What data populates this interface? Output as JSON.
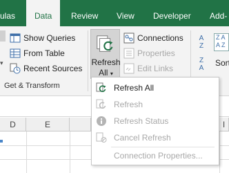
{
  "tabs": [
    "ulas",
    "Data",
    "Review",
    "View",
    "Developer",
    "Add-"
  ],
  "ribbon": {
    "queries": {
      "show_queries": "Show Queries",
      "from_table": "From Table",
      "recent_sources": "Recent Sources"
    },
    "group_get_transform": "Get & Transform",
    "refresh_all_line1": "Refresh",
    "refresh_all_line2": "All",
    "connections": {
      "connections": "Connections",
      "properties": "Properties",
      "edit_links": "Edit Links"
    },
    "sort_label": "Sort",
    "sort_az_top": "A",
    "sort_az_bottom": "Z",
    "sort_za_top": "Z",
    "sort_za_bottom": "A"
  },
  "sheet": {
    "columns": [
      "D",
      "E",
      "I"
    ]
  },
  "menu": {
    "items": [
      {
        "label": "Refresh All",
        "enabled": true
      },
      {
        "label": "Refresh",
        "enabled": false
      },
      {
        "label": "Refresh Status",
        "enabled": false
      },
      {
        "label": "Cancel Refresh",
        "enabled": false
      },
      {
        "label": "Connection Properties...",
        "enabled": false
      }
    ]
  },
  "colors": {
    "tab_bar": "#217346",
    "ribbon": "#f3f3f3",
    "accent_green": "#217346",
    "disabled_text": "#a8a8a8"
  }
}
